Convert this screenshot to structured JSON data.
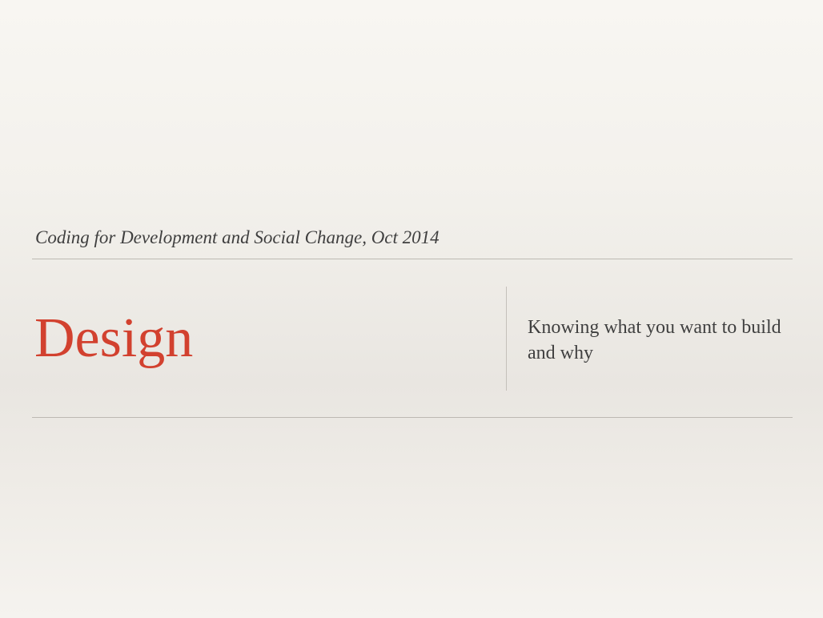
{
  "slide": {
    "subtitle": "Coding for Development and Social Change, Oct 2014",
    "title": "Design",
    "tagline": "Knowing what you want to build and why"
  },
  "colors": {
    "title": "#d2412f",
    "text": "#3f3f3f",
    "rule": "#bdb9b3",
    "background": "#f3f1ec"
  }
}
